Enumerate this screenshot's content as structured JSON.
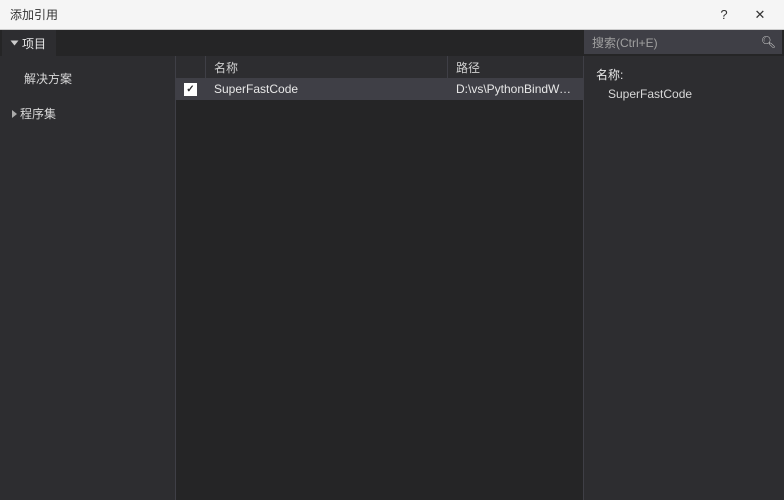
{
  "titlebar": {
    "title": "添加引用",
    "help": "?",
    "close": "✕"
  },
  "tab": {
    "label": "项目"
  },
  "search": {
    "placeholder": "搜索(Ctrl+E)"
  },
  "sidebar": {
    "items": [
      {
        "label": "解决方案"
      },
      {
        "label": "程序集"
      }
    ]
  },
  "table": {
    "headers": {
      "name": "名称",
      "path": "路径"
    },
    "rows": [
      {
        "checked": true,
        "name": "SuperFastCode",
        "path": "D:\\vs\\PythonBindWa..."
      }
    ]
  },
  "detail": {
    "label": "名称:",
    "value": "SuperFastCode"
  }
}
